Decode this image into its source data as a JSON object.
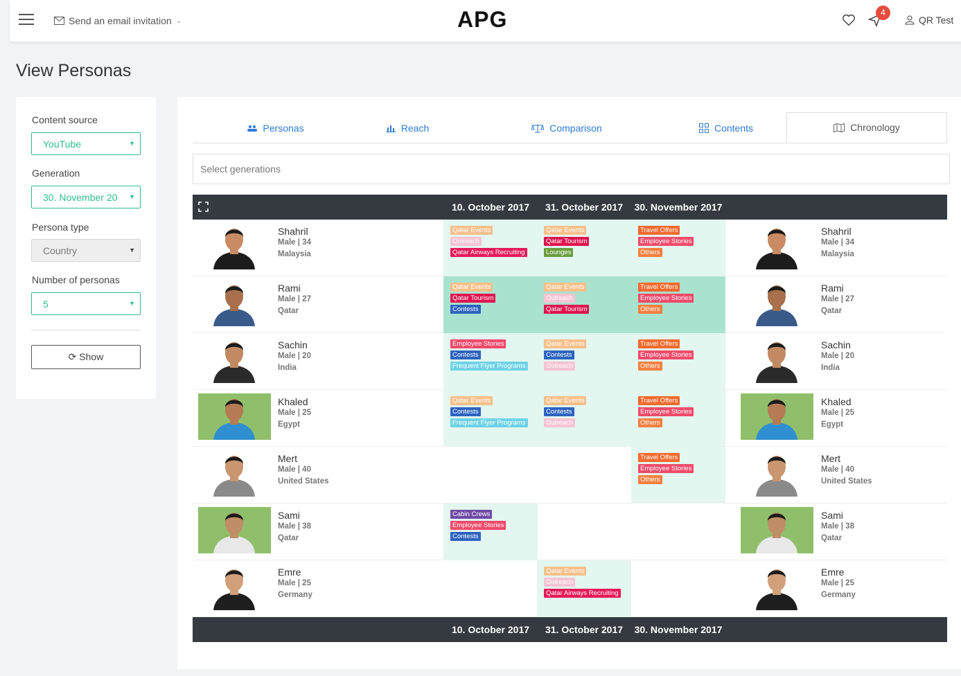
{
  "header": {
    "invite_label": "Send an email invitation",
    "logo": "APG",
    "notification_count": "4",
    "user_name": "QR Test"
  },
  "page_title": "View Personas",
  "filters": {
    "content_source_label": "Content source",
    "content_source_value": "YouTube",
    "generation_label": "Generation",
    "generation_value": "30. November 20",
    "persona_type_label": "Persona type",
    "persona_type_value": "Country",
    "number_label": "Number of personas",
    "number_value": "5",
    "show_button": "Show"
  },
  "tabs": [
    {
      "label": "Personas",
      "icon": "users-icon"
    },
    {
      "label": "Reach",
      "icon": "bar-chart-icon"
    },
    {
      "label": "Comparison",
      "icon": "scale-icon"
    },
    {
      "label": "Contents",
      "icon": "grid-icon"
    },
    {
      "label": "Chronology",
      "icon": "map-icon"
    }
  ],
  "select_generations_placeholder": "Select generations",
  "dates": [
    "10. October 2017",
    "31. October 2017",
    "30. November 2017"
  ],
  "tag_colors": {
    "Qatar Events": "#f7c08a",
    "Outreach": "#f8c3d4",
    "Qatar Airways Recruiting": "#e6195a",
    "Qatar Tourism": "#e0134f",
    "Lounges": "#6b9e3e",
    "Travel Offers": "#f26a2e",
    "Employee Stories": "#f04a6a",
    "Others": "#f48040",
    "Contests": "#2d63c0",
    "Frequent Flyer Programs": "#6fd3e6",
    "Cabin Crews": "#6f4aa6"
  },
  "personas": [
    {
      "name": "Shahril",
      "meta": "Male | 34",
      "country": "Malaysia",
      "cells": [
        {
          "bg": "light",
          "tags": [
            "Qatar Events",
            "Outreach",
            "Qatar Airways Recruiting"
          ]
        },
        {
          "bg": "light",
          "tags": [
            "Qatar Events",
            "Qatar Tourism",
            "Lounges"
          ]
        },
        {
          "bg": "light",
          "tags": [
            "Travel Offers",
            "Employee Stories",
            "Others"
          ]
        }
      ]
    },
    {
      "name": "Rami",
      "meta": "Male | 27",
      "country": "Qatar",
      "cells": [
        {
          "bg": "mid",
          "tags": [
            "Qatar Events",
            "Qatar Tourism",
            "Contests"
          ]
        },
        {
          "bg": "mid",
          "tags": [
            "Qatar Events",
            "Outreach",
            "Qatar Tourism"
          ]
        },
        {
          "bg": "mid",
          "tags": [
            "Travel Offers",
            "Employee Stories",
            "Others"
          ]
        }
      ]
    },
    {
      "name": "Sachin",
      "meta": "Male | 20",
      "country": "India",
      "cells": [
        {
          "bg": "light",
          "tags": [
            "Employee Stories",
            "Contests",
            "Frequent Flyer Programs"
          ]
        },
        {
          "bg": "light",
          "tags": [
            "Qatar Events",
            "Contests",
            "Outreach"
          ]
        },
        {
          "bg": "light",
          "tags": [
            "Travel Offers",
            "Employee Stories",
            "Others"
          ]
        }
      ]
    },
    {
      "name": "Khaled",
      "meta": "Male | 25",
      "country": "Egypt",
      "cells": [
        {
          "bg": "light",
          "tags": [
            "Qatar Events",
            "Contests",
            "Frequent Flyer Programs"
          ]
        },
        {
          "bg": "light",
          "tags": [
            "Qatar Events",
            "Contests",
            "Outreach"
          ]
        },
        {
          "bg": "light",
          "tags": [
            "Travel Offers",
            "Employee Stories",
            "Others"
          ]
        }
      ]
    },
    {
      "name": "Mert",
      "meta": "Male | 40",
      "country": "United States",
      "cells": [
        {
          "bg": "none",
          "tags": []
        },
        {
          "bg": "none",
          "tags": []
        },
        {
          "bg": "light",
          "tags": [
            "Travel Offers",
            "Employee Stories",
            "Others"
          ]
        }
      ]
    },
    {
      "name": "Sami",
      "meta": "Male | 38",
      "country": "Qatar",
      "cells": [
        {
          "bg": "light",
          "tags": [
            "Cabin Crews",
            "Employee Stories",
            "Contests"
          ]
        },
        {
          "bg": "none",
          "tags": []
        },
        {
          "bg": "none",
          "tags": []
        }
      ]
    },
    {
      "name": "Emre",
      "meta": "Male | 25",
      "country": "Germany",
      "cells": [
        {
          "bg": "none",
          "tags": []
        },
        {
          "bg": "light",
          "tags": [
            "Qatar Events",
            "Outreach",
            "Qatar Airways Recruiting"
          ]
        },
        {
          "bg": "none",
          "tags": []
        }
      ]
    }
  ]
}
